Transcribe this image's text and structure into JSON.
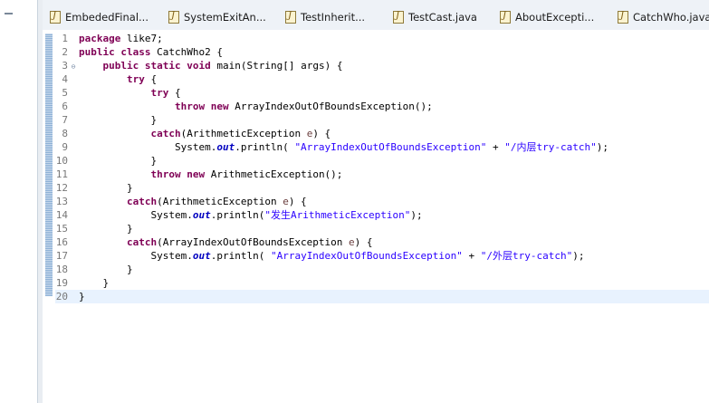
{
  "tabs": [
    {
      "label": "EmbededFinal..."
    },
    {
      "label": "SystemExitAn..."
    },
    {
      "label": "TestInherit..."
    },
    {
      "label": "TestCast.java"
    },
    {
      "label": "AboutExcepti..."
    },
    {
      "label": "CatchWho.java"
    }
  ],
  "editor": {
    "lines": [
      {
        "num": "1",
        "code": "package like7;"
      },
      {
        "num": "2",
        "code": "public class CatchWho2 {"
      },
      {
        "num": "3",
        "code": "    public static void main(String[] args) {"
      },
      {
        "num": "4",
        "code": "        try {"
      },
      {
        "num": "5",
        "code": "            try {"
      },
      {
        "num": "6",
        "code": "                throw new ArrayIndexOutOfBoundsException();"
      },
      {
        "num": "7",
        "code": "            }"
      },
      {
        "num": "8",
        "code": "            catch(ArithmeticException e) {"
      },
      {
        "num": "9",
        "code": "                System.out.println( \"ArrayIndexOutOfBoundsException\" + \"/内层try-catch\");"
      },
      {
        "num": "10",
        "code": "            }"
      },
      {
        "num": "11",
        "code": "            throw new ArithmeticException();"
      },
      {
        "num": "12",
        "code": "        }"
      },
      {
        "num": "13",
        "code": "        catch(ArithmeticException e) {"
      },
      {
        "num": "14",
        "code": "            System.out.println(\"发生ArithmeticException\");"
      },
      {
        "num": "15",
        "code": "        }"
      },
      {
        "num": "16",
        "code": "        catch(ArrayIndexOutOfBoundsException e) {"
      },
      {
        "num": "17",
        "code": "            System.out.println( \"ArrayIndexOutOfBoundsException\" + \"/外层try-catch\");"
      },
      {
        "num": "18",
        "code": "        }"
      },
      {
        "num": "19",
        "code": "    }"
      },
      {
        "num": "20",
        "code": "}"
      }
    ]
  },
  "colors": {
    "keyword": "#7f0055",
    "string": "#2a00ff",
    "field": "#0000c0",
    "current_line": "#e8f2fe"
  }
}
